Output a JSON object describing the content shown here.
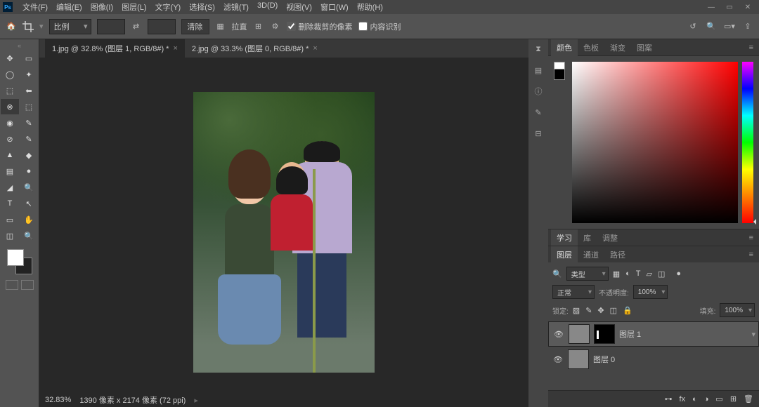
{
  "menu": {
    "items": [
      "文件(F)",
      "编辑(E)",
      "图像(I)",
      "图层(L)",
      "文字(Y)",
      "选择(S)",
      "滤镜(T)",
      "3D(D)",
      "视图(V)",
      "窗口(W)",
      "帮助(H)"
    ]
  },
  "options": {
    "ratio": "比例",
    "swap": "⇄",
    "clear": "清除",
    "straighten": "拉直",
    "deletePixels": "删除裁剪的像素",
    "contentAware": "内容识别"
  },
  "tabs": [
    {
      "label": "1.jpg @ 32.8% (图层 1, RGB/8#) *",
      "active": true
    },
    {
      "label": "2.jpg @ 33.3% (图层 0, RGB/8#) *",
      "active": false
    }
  ],
  "status": {
    "zoom": "32.83%",
    "dims": "1390 像素 x 2174 像素 (72 ppi)"
  },
  "colorTabs": [
    "颜色",
    "色板",
    "渐变",
    "图案"
  ],
  "midTabs1": [
    "学习",
    "库",
    "调整"
  ],
  "midTabs2": [
    "图层",
    "通道",
    "路径"
  ],
  "layers": {
    "kind": "类型",
    "blend": "正常",
    "opacityLabel": "不透明度:",
    "opacity": "100%",
    "lockLabel": "锁定:",
    "fillLabel": "填充:",
    "fill": "100%",
    "items": [
      {
        "name": "图层 1",
        "selected": true,
        "hasMask": true
      },
      {
        "name": "图层 0",
        "selected": false,
        "hasMask": false
      }
    ]
  }
}
